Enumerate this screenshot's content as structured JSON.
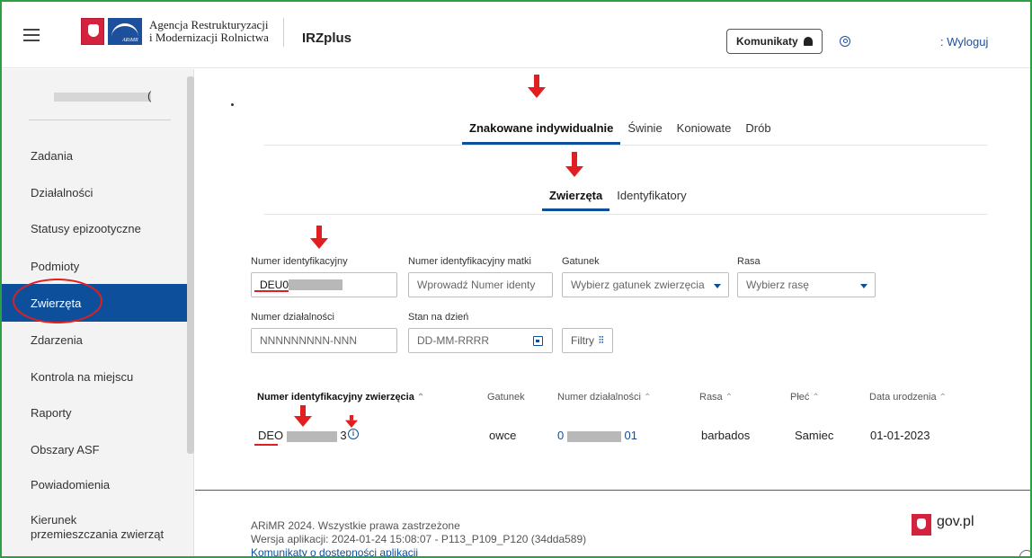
{
  "header": {
    "agency_line1": "Agencja Restrukturyzacji",
    "agency_line2": "i Modernizacji Rolnictwa",
    "logo_text": "ARiMR",
    "app_title": "IRZplus",
    "komunikaty_label": "Komunikaty",
    "logout_label": ": Wyloguj"
  },
  "sidebar": {
    "user_fragment": "(",
    "items": [
      {
        "label": "Zadania"
      },
      {
        "label": "Działalności"
      },
      {
        "label": "Statusy epizootyczne"
      },
      {
        "label": "Podmioty"
      },
      {
        "label": "Zwierzęta"
      },
      {
        "label": "Zdarzenia"
      },
      {
        "label": "Kontrola na miejscu"
      },
      {
        "label": "Raporty"
      },
      {
        "label": "Obszary ASF"
      },
      {
        "label": "Powiadomienia"
      },
      {
        "label": "Kierunek przemieszczania zwierząt"
      }
    ],
    "active_index": 4
  },
  "tabs_primary": [
    "Znakowane indywidualnie",
    "Świnie",
    "Koniowate",
    "Drób"
  ],
  "tabs_secondary": [
    "Zwierzęta",
    "Identyfikatory"
  ],
  "filters": {
    "id_label": "Numer identyfikacyjny",
    "id_value": "DEU0",
    "mother_label": "Numer identyfikacyjny matki",
    "mother_placeholder": "Wprowadź Numer identy",
    "species_label": "Gatunek",
    "species_placeholder": "Wybierz gatunek zwierzęcia",
    "breed_label": "Rasa",
    "breed_placeholder": "Wybierz rasę",
    "activity_label": "Numer działalności",
    "activity_placeholder": "NNNNNNNNN-NNN",
    "date_label": "Stan na dzień",
    "date_placeholder": "DD-MM-RRRR",
    "filters_button": "Filtry"
  },
  "table": {
    "headers": [
      "Numer identyfikacyjny zwierzęcia",
      "Gatunek",
      "Numer działalności",
      "Rasa",
      "Płeć",
      "Data urodzenia"
    ],
    "row": {
      "id_prefix": "DEO",
      "id_suffix": "3",
      "species": "owce",
      "activity_prefix": "0",
      "activity_suffix": "01",
      "breed": "barbados",
      "sex": "Samiec",
      "birth_date": "01-01-2023"
    }
  },
  "footer": {
    "copyright": "ARiMR 2024. Wszystkie prawa zastrzeżone",
    "version": "Wersja aplikacji: 2024-01-24 15:08:07 - P113_P109_P120 (34dda589)",
    "accessibility_link": "Komunikaty o dostępności aplikacji",
    "gov_label": "gov.pl"
  },
  "colors": {
    "primary": "#0d4f9b",
    "annotation_red": "#e02020",
    "frame_green": "#2ea043"
  }
}
